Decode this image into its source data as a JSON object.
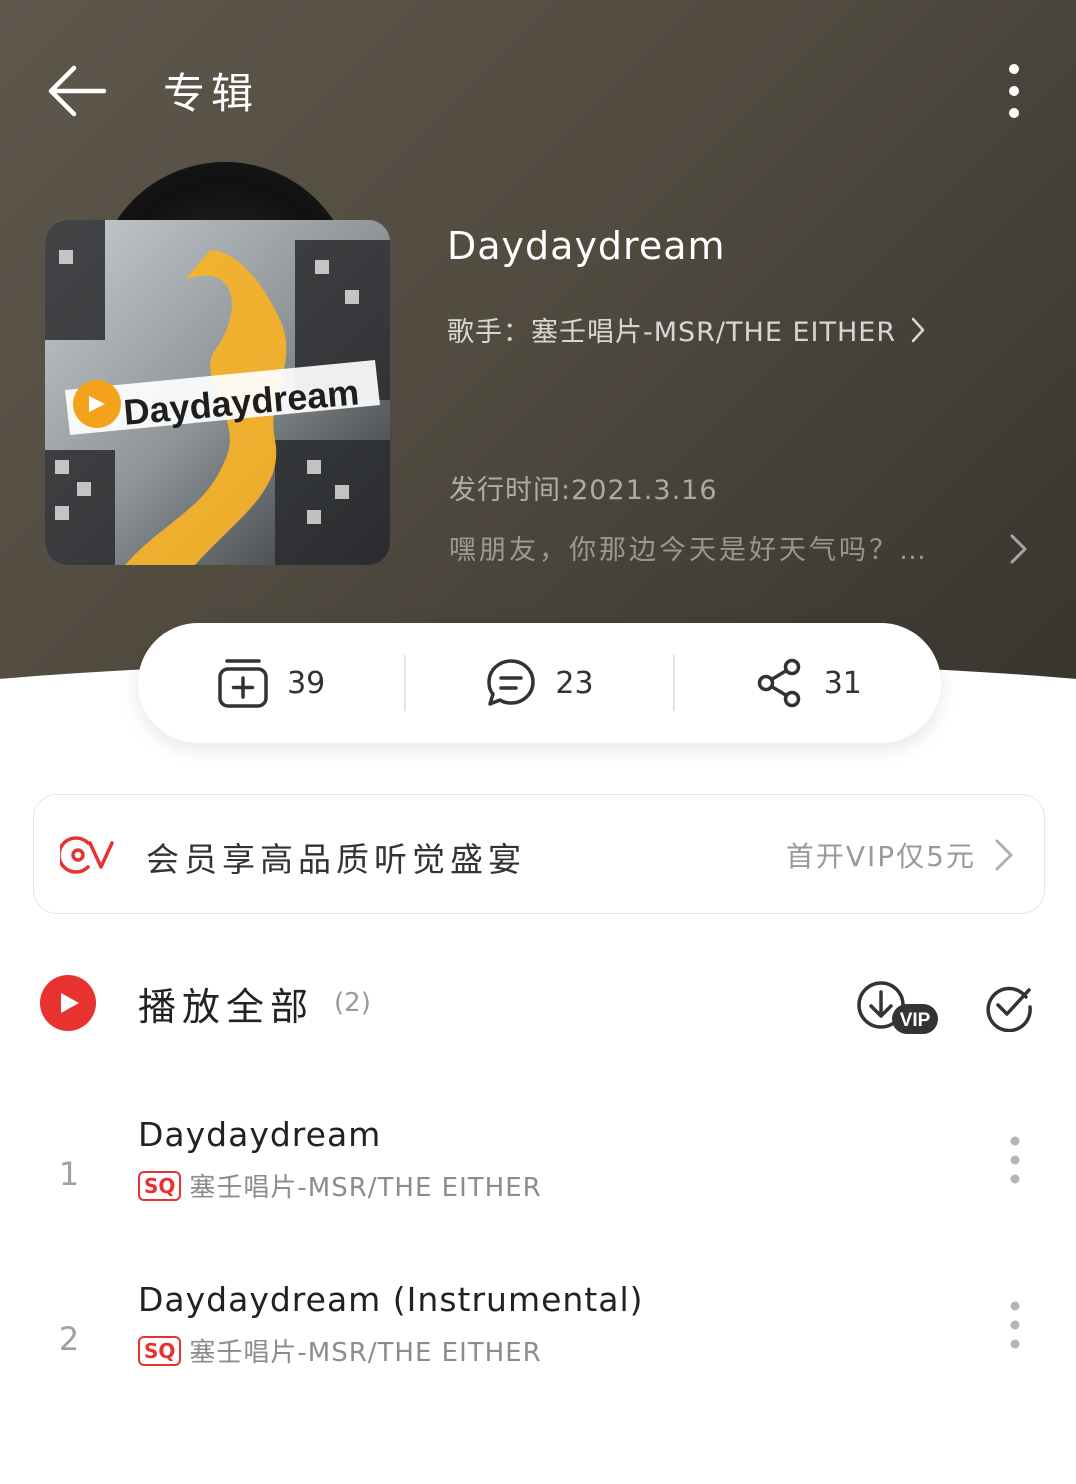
{
  "header": {
    "title": "专辑",
    "back_icon": "arrow-left-icon",
    "more_icon": "more-vertical-icon"
  },
  "album": {
    "title": "Daydaydream",
    "cover_text": "Daydaydream",
    "artist_line": "歌手：塞壬唱片-MSR/THE EITHER",
    "release": "发行时间:2021.3.16",
    "description": "嘿朋友，你那边今天是好天气吗？…"
  },
  "stats": {
    "collect": "39",
    "comments": "23",
    "shares": "31"
  },
  "vip_banner": {
    "text": "会员享高品质听觉盛宴",
    "offer": "首开VIP仅5元"
  },
  "play_all": {
    "label": "播放全部",
    "count": "(2)",
    "vip_badge": "VIP"
  },
  "tracks": [
    {
      "number": "1",
      "title": "Daydaydream",
      "quality": "SQ",
      "artist": "塞壬唱片-MSR/THE EITHER"
    },
    {
      "number": "2",
      "title": "Daydaydream (Instrumental)",
      "quality": "SQ",
      "artist": "塞壬唱片-MSR/THE EITHER"
    }
  ],
  "colors": {
    "accent": "#e8322f",
    "hero_start": "#5d574c",
    "hero_end": "#38352f"
  }
}
